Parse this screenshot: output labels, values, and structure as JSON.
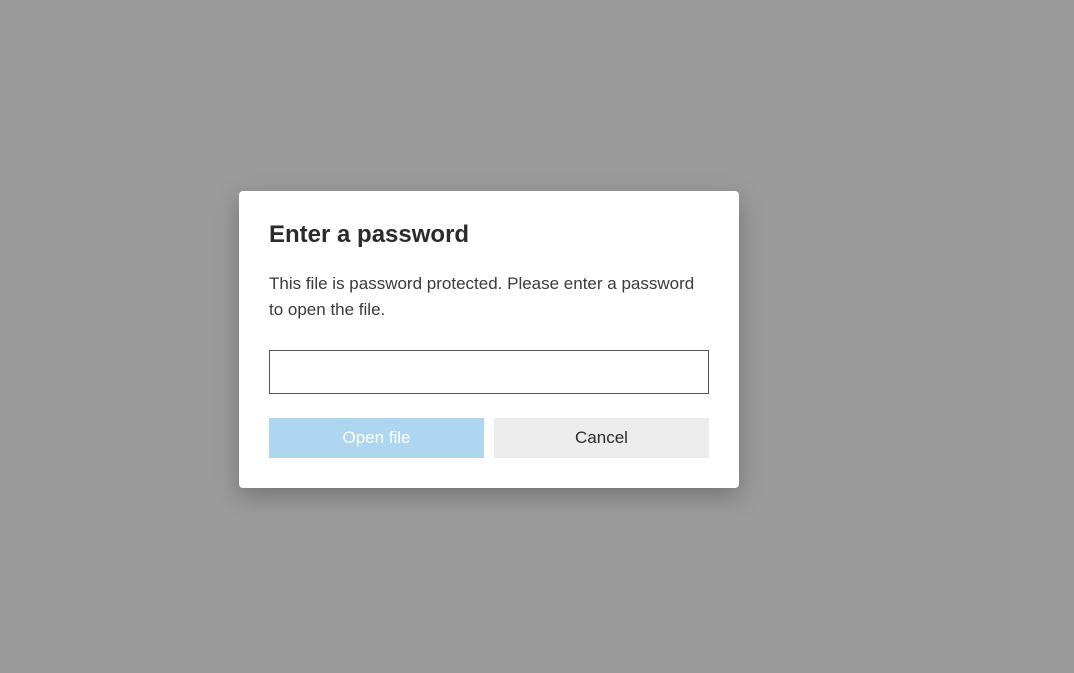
{
  "dialog": {
    "title": "Enter a password",
    "description": "This file is password protected. Please enter a password to open the file.",
    "password_value": "",
    "buttons": {
      "primary_label": "Open file",
      "secondary_label": "Cancel"
    }
  }
}
